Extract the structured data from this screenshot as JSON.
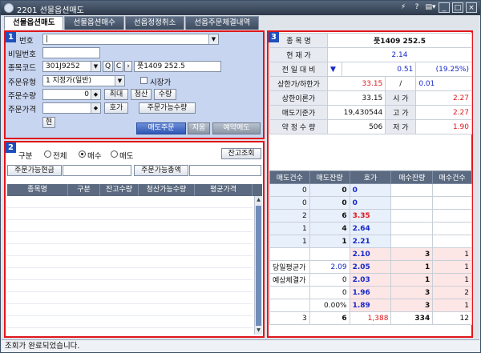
{
  "window": {
    "title": "2201 선물옵션매도",
    "title_buttons": [
      "⚡",
      "?",
      "▤▾",
      "_",
      "□",
      "×"
    ]
  },
  "tabs": [
    {
      "label": "선물옵션매도"
    },
    {
      "label": "선물옵션매수"
    },
    {
      "label": "선옵정정취소"
    },
    {
      "label": "선옵주문체결내역"
    }
  ],
  "order_panel": {
    "badge": "1",
    "account_label": "번호",
    "password_label": "비밀번호",
    "code_label": "종목코드",
    "code_value": "301J9252",
    "code_btn_search": "Q",
    "code_btn_c": "C",
    "code_btn_next": "›",
    "code_name": "풋1409 252.5",
    "order_type_label": "주문유형",
    "order_type_value": "1 지정가(일반)",
    "market_price_label": "시장가",
    "qty_label": "주문수량",
    "qty_value": "0",
    "btn_max": "최대",
    "btn_clear": "청산",
    "btn_qty": "수량",
    "price_label": "주문가격",
    "btn_price": "호가",
    "btn_orderable_qty": "주문가능수량",
    "btn_current": "현",
    "btn_sell": "매도주문",
    "btn_reset": "지움",
    "btn_reserve": "예약매도"
  },
  "balance_panel": {
    "badge": "2",
    "filter_label": "구분",
    "radio_all": "전체",
    "radio_buy": "매수",
    "radio_sell": "매도",
    "btn_query": "잔고조회",
    "btn_cash": "주문가능현금",
    "btn_amount": "주문가능총액",
    "columns": [
      "종목명",
      "구분",
      "잔고수량",
      "청산가능수량",
      "평균가격"
    ]
  },
  "quote_panel": {
    "badge": "3",
    "info": [
      {
        "label": "종 목 명",
        "value": "풋1409 252.5"
      },
      {
        "label": "현 재 가",
        "value": "2.14"
      },
      {
        "label": "전 일 대 비",
        "arrow": "▼",
        "value": "0.51",
        "pct": "(19.25%)"
      },
      {
        "label": "상한가/하한가",
        "upper": "33.15",
        "sep": "/",
        "lower": "0.01"
      },
      {
        "label": "상한이론가",
        "value": "33.15",
        "label2": "시 가",
        "value2": "2.27"
      },
      {
        "label": "매도기준가",
        "value": "19,430544",
        "label2": "고 가",
        "value2": "2.27"
      },
      {
        "label": "약 정 수 량",
        "value": "506",
        "label2": "저 가",
        "value2": "1.90"
      }
    ],
    "book_columns": [
      "매도건수",
      "매도잔량",
      "호가",
      "매수잔량",
      "매수건수"
    ],
    "asks": [
      {
        "cnt": "0",
        "qty": "0",
        "price": "0"
      },
      {
        "cnt": "0",
        "qty": "0",
        "price": "0"
      },
      {
        "cnt": "2",
        "qty": "6",
        "price": "3.35"
      },
      {
        "cnt": "1",
        "qty": "4",
        "price": "2.64"
      },
      {
        "cnt": "1",
        "qty": "1",
        "price": "2.21"
      }
    ],
    "bids": [
      {
        "label": "",
        "val": "",
        "price": "2.10",
        "qty": "3",
        "cnt": "1"
      },
      {
        "label": "당일평균가",
        "val": "2.09",
        "price": "2.05",
        "qty": "1",
        "cnt": "1"
      },
      {
        "label": "예상체결가",
        "val": "0",
        "price": "2.03",
        "qty": "1",
        "cnt": "1"
      },
      {
        "label": "",
        "val": "0",
        "price": "1.96",
        "qty": "3",
        "cnt": "2"
      },
      {
        "label": "",
        "val": "0.00%",
        "price": "1.89",
        "qty": "3",
        "cnt": "1"
      }
    ],
    "totals": {
      "ask_cnt": "3",
      "ask_qty": "6",
      "mid": "1,388",
      "bid_qty": "334",
      "bid_cnt": "12"
    }
  },
  "status": {
    "text": "조회가 완료되었습니다."
  }
}
